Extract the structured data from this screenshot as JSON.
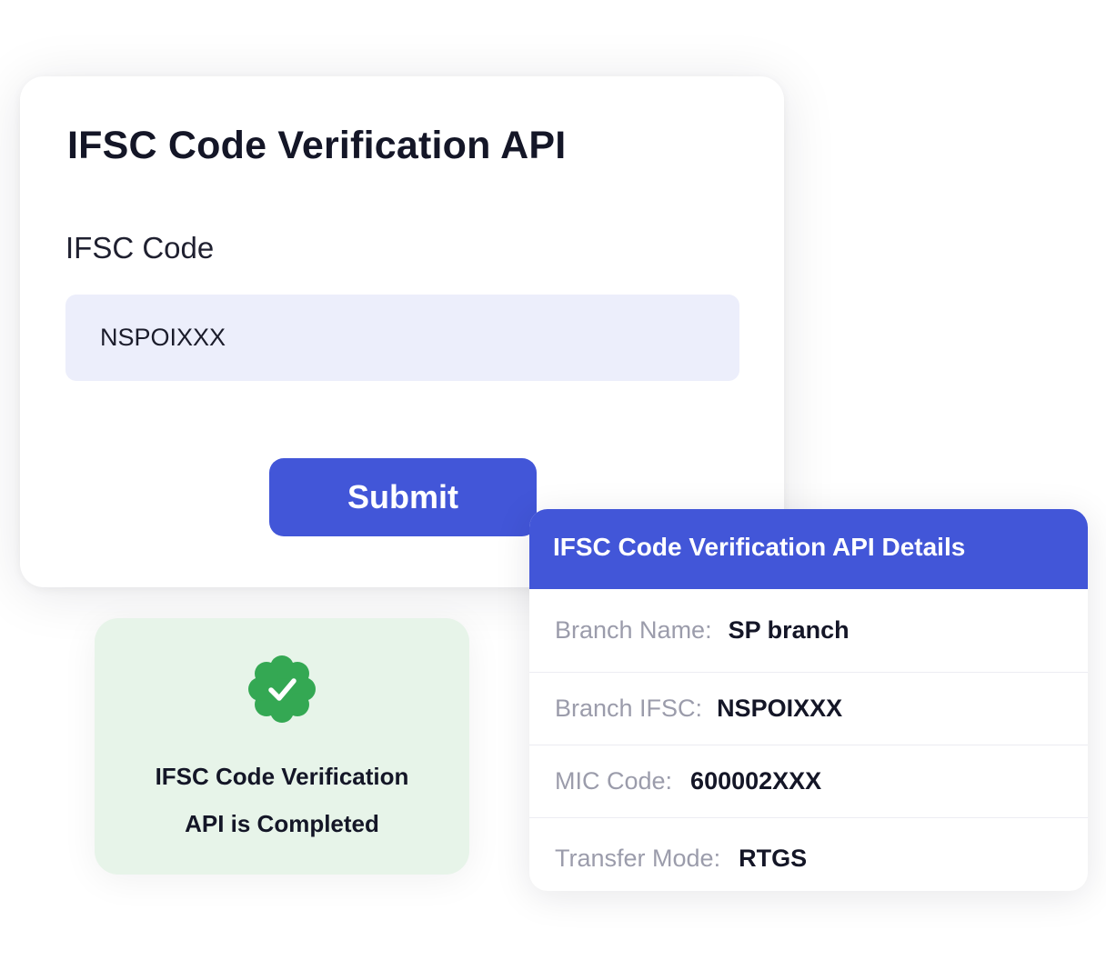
{
  "form": {
    "title": "IFSC Code Verification API",
    "field_label": "IFSC Code",
    "ifsc_value": "NSPOIXXX",
    "submit_label": "Submit"
  },
  "success": {
    "line1": "IFSC Code Verification",
    "line2": "API is Completed",
    "icon": "verified-check-badge-icon",
    "color": "#34a853"
  },
  "details": {
    "title": "IFSC Code Verification API Details",
    "rows": [
      {
        "label": "Branch Name:",
        "value": "SP branch"
      },
      {
        "label": "Branch IFSC:",
        "value": "NSPOIXXX"
      },
      {
        "label": "MIC Code:",
        "value": "600002XXX"
      },
      {
        "label": "Transfer Mode:",
        "value": "RTGS"
      }
    ]
  },
  "colors": {
    "accent": "#4256d8",
    "input_bg": "#eceefb",
    "success_bg": "#e7f4e9"
  }
}
